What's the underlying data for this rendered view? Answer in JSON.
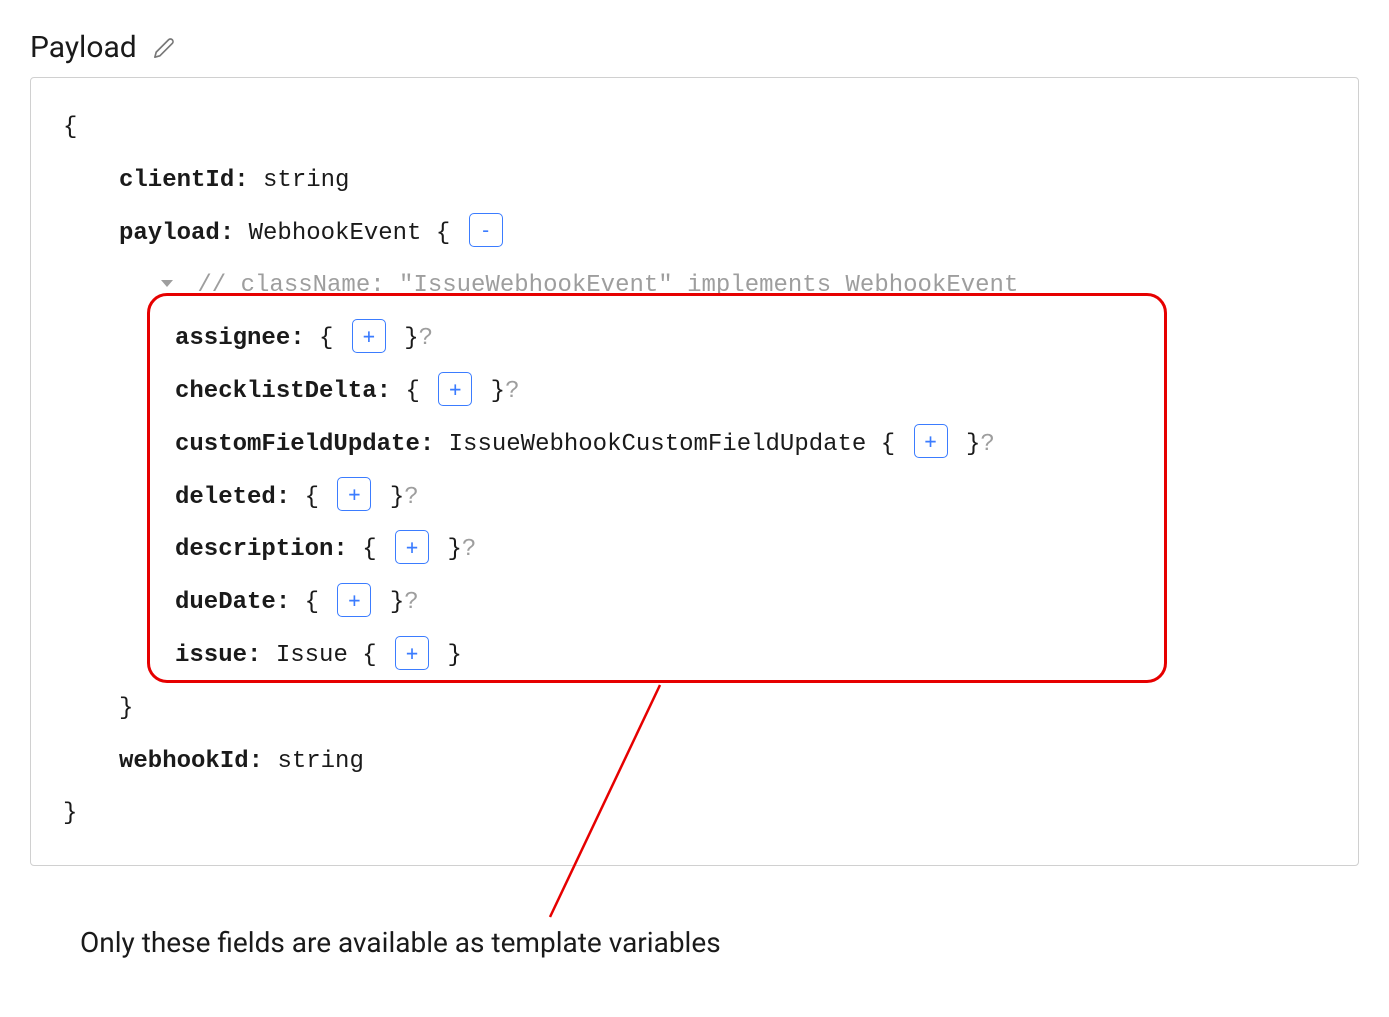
{
  "header": {
    "title": "Payload"
  },
  "schema": {
    "open": "{",
    "close": "}",
    "clientId": {
      "key": "clientId:",
      "type": "string"
    },
    "payload": {
      "key": "payload:",
      "type": "WebhookEvent {",
      "collapseSymbol": "-",
      "comment": "// className: \"IssueWebhookEvent\" implements WebhookEvent",
      "fields": {
        "assignee": {
          "key": "assignee:",
          "open": "{",
          "expand": "+",
          "close": "}",
          "opt": "?"
        },
        "checklistDelta": {
          "key": "checklistDelta:",
          "open": "{",
          "expand": "+",
          "close": "}",
          "opt": "?"
        },
        "customFieldUpdate": {
          "key": "customFieldUpdate:",
          "type": "IssueWebhookCustomFieldUpdate {",
          "expand": "+",
          "close": "}",
          "opt": "?"
        },
        "deleted": {
          "key": "deleted:",
          "open": "{",
          "expand": "+",
          "close": "}",
          "opt": "?"
        },
        "description": {
          "key": "description:",
          "open": "{",
          "expand": "+",
          "close": "}",
          "opt": "?"
        },
        "dueDate": {
          "key": "dueDate:",
          "open": "{",
          "expand": "+",
          "close": "}",
          "opt": "?"
        },
        "issue": {
          "key": "issue:",
          "type": "Issue {",
          "expand": "+",
          "close": "}"
        }
      },
      "close": "}"
    },
    "webhookId": {
      "key": "webhookId:",
      "type": "string"
    }
  },
  "annotation": "Only these fields are available as template variables",
  "colors": {
    "border_highlight": "#e60000",
    "expand_button": "#3b7cff"
  }
}
